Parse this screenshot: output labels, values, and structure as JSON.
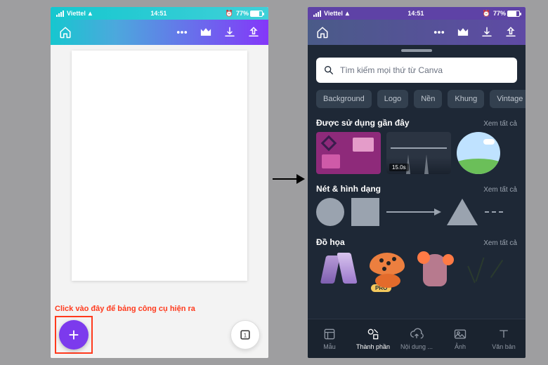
{
  "status": {
    "carrier": "Viettel",
    "time": "14:51",
    "battery_pct": "77%",
    "alarm_icon": "⏰"
  },
  "left": {
    "annotation": "Click vào đây để bảng công cụ hiện ra",
    "fab_label": "+",
    "page_count": "1"
  },
  "right": {
    "search_placeholder": "Tìm kiếm mọi thứ từ Canva",
    "tabs": [
      "Background",
      "Logo",
      "Nền",
      "Khung",
      "Vintage"
    ],
    "sections": {
      "recent": {
        "title": "Được sử dụng gần đây",
        "see_all": "Xem tất cả",
        "video_duration": "15.0s"
      },
      "shapes": {
        "title": "Nét & hình dạng",
        "see_all": "Xem tất cả"
      },
      "graphics": {
        "title": "Đồ họa",
        "see_all": "Xem tất cả",
        "pro_label": "PRO"
      }
    },
    "bottom_nav": [
      {
        "label": "Mẫu"
      },
      {
        "label": "Thành phần"
      },
      {
        "label": "Nội dung ..."
      },
      {
        "label": "Ảnh"
      },
      {
        "label": "Văn bản"
      }
    ]
  }
}
